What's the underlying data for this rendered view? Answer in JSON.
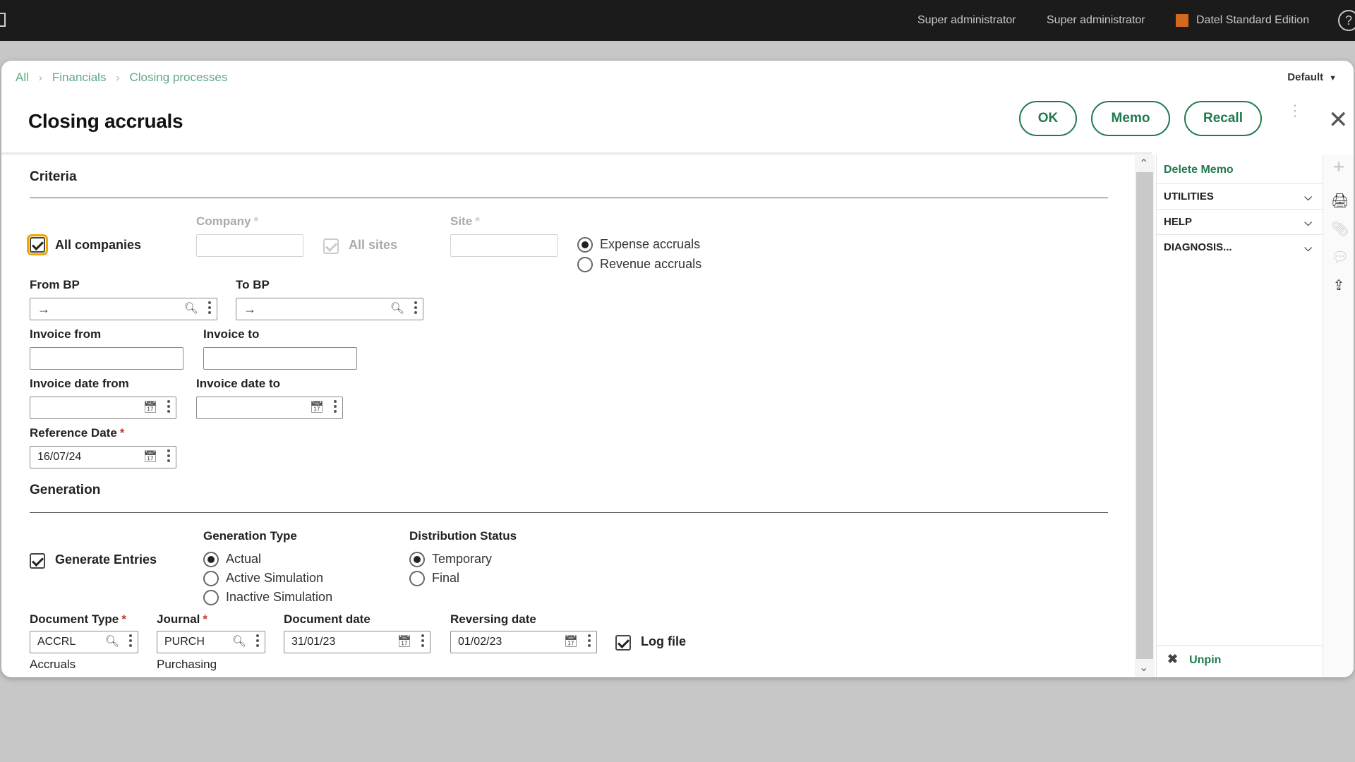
{
  "topbar": {
    "user_primary": "Super administrator",
    "user_secondary": "Super administrator",
    "edition": "Datel Standard Edition",
    "edition_color": "#d2691e",
    "help_glyph": "?"
  },
  "breadcrumb": {
    "items": [
      "All",
      "Financials",
      "Closing processes"
    ]
  },
  "view_selector": {
    "label": "Default"
  },
  "page": {
    "title": "Closing accruals"
  },
  "actions": {
    "ok": "OK",
    "memo": "Memo",
    "recall": "Recall"
  },
  "criteria": {
    "title": "Criteria",
    "all_companies": {
      "label": "All companies",
      "checked": true
    },
    "company": {
      "label": "Company",
      "required_mark": "*",
      "value": ""
    },
    "all_sites": {
      "label": "All sites",
      "checked": true,
      "disabled": true
    },
    "site": {
      "label": "Site",
      "required_mark": "*",
      "value": ""
    },
    "accrual_type": {
      "options": [
        "Expense accruals",
        "Revenue accruals"
      ],
      "selected": "Expense accruals"
    },
    "from_bp": {
      "label": "From BP",
      "value": ""
    },
    "to_bp": {
      "label": "To BP",
      "value": ""
    },
    "invoice_from": {
      "label": "Invoice from",
      "value": ""
    },
    "invoice_to": {
      "label": "Invoice to",
      "value": ""
    },
    "invoice_date_from": {
      "label": "Invoice date from",
      "value": ""
    },
    "invoice_date_to": {
      "label": "Invoice date to",
      "value": ""
    },
    "reference_date": {
      "label": "Reference Date",
      "required_mark": "*",
      "value": "16/07/24"
    }
  },
  "generation": {
    "title": "Generation",
    "generate_entries": {
      "label": "Generate Entries",
      "checked": true
    },
    "generation_type": {
      "label": "Generation Type",
      "options": [
        "Actual",
        "Active Simulation",
        "Inactive Simulation"
      ],
      "selected": "Actual"
    },
    "distribution_status": {
      "label": "Distribution Status",
      "options": [
        "Temporary",
        "Final"
      ],
      "selected": "Temporary"
    },
    "document_type": {
      "label": "Document Type",
      "required_mark": "*",
      "value": "ACCRL",
      "description": "Accruals"
    },
    "journal": {
      "label": "Journal",
      "required_mark": "*",
      "value": "PURCH",
      "description": "Purchasing"
    },
    "document_date": {
      "label": "Document date",
      "value": "31/01/23"
    },
    "reversing_date": {
      "label": "Reversing date",
      "value": "01/02/23"
    },
    "log_file": {
      "label": "Log file",
      "checked": true
    }
  },
  "side_panel": {
    "delete_memo": "Delete Memo",
    "sections": [
      "UTILITIES",
      "HELP",
      "DIAGNOSIS..."
    ],
    "unpin": "Unpin"
  },
  "toolstrip": {
    "icons": [
      "plus-icon",
      "print-icon",
      "paperclip-icon",
      "comment-icon",
      "share-icon"
    ]
  },
  "colors": {
    "accent": "#1f7a4d",
    "breadcrumb": "#5fa882",
    "required": "#c0392b",
    "focus": "#f0a500"
  }
}
